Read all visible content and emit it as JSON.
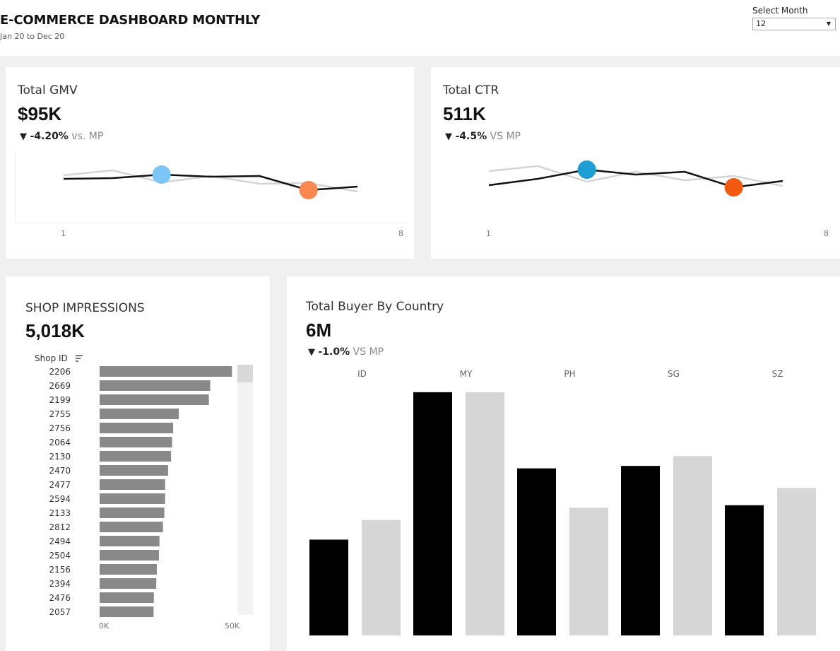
{
  "header": {
    "title": "E-COMMERCE DASHBOARD MONTHLY",
    "subtitle": "Jan 20 to Dec 20",
    "filter_label": "Select Month",
    "filter_value": "12"
  },
  "gmv": {
    "title": "Total GMV",
    "value": "$95K",
    "delta_arrow": "▼",
    "delta_pct": "-4.20%",
    "delta_suffix": "vs. MP",
    "x_start": "1",
    "x_end": "8",
    "highlight_high_color": "#7cc6f7",
    "highlight_low_color": "#f98850"
  },
  "ctr": {
    "title": "Total CTR",
    "value": "511K",
    "delta_arrow": "▼",
    "delta_pct": "-4.5%",
    "delta_suffix": "VS MP",
    "x_start": "1",
    "x_end": "8",
    "highlight_high_color": "#1f9ed6",
    "highlight_low_color": "#f25a0f"
  },
  "shops": {
    "title": "SHOP IMPRESSIONS",
    "value": "5,018K",
    "column_header": "Shop ID",
    "axis_start": "0K",
    "axis_end": "50K"
  },
  "buyers": {
    "title": "Total Buyer By Country",
    "value": "6M",
    "delta_arrow": "▼",
    "delta_pct": "-1.0%",
    "delta_suffix": "VS MP"
  },
  "chart_data": [
    {
      "type": "line",
      "x": [
        1,
        2,
        3,
        4,
        5,
        6,
        7,
        8
      ],
      "series": [
        {
          "values": [
            0.62,
            0.63,
            0.68,
            0.65,
            0.66,
            0.46,
            0.51
          ]
        },
        {
          "values": [
            0.67,
            0.74,
            0.57,
            0.66,
            0.55,
            0.56,
            0.44
          ]
        }
      ],
      "highlights": {
        "high_index": 2,
        "low_index": 5
      },
      "color_current": "#111111",
      "color_previous": "#d4d4d4"
    },
    {
      "type": "line",
      "x": [
        1,
        2,
        3,
        4,
        5,
        6,
        7,
        8
      ],
      "series": [
        {
          "values": [
            0.53,
            0.62,
            0.75,
            0.68,
            0.72,
            0.5,
            0.59
          ]
        },
        {
          "values": [
            0.73,
            0.8,
            0.58,
            0.72,
            0.6,
            0.66,
            0.52
          ]
        }
      ],
      "highlights": {
        "high_index": 2,
        "low_index": 5
      },
      "color_current": "#111111",
      "color_previous": "#d4d4d4"
    },
    {
      "type": "bar",
      "orientation": "horizontal",
      "categories": [
        "2206",
        "2669",
        "2199",
        "2755",
        "2756",
        "2064",
        "2130",
        "2470",
        "2477",
        "2594",
        "2133",
        "2812",
        "2494",
        "2504",
        "2156",
        "2394",
        "2476",
        "2057"
      ],
      "values": [
        49.3,
        41.2,
        40.7,
        29.5,
        27.4,
        27.0,
        26.6,
        25.5,
        24.4,
        24.4,
        24.1,
        23.6,
        22.3,
        22.1,
        21.3,
        21.1,
        20.2,
        20.1
      ],
      "xlim": [
        0,
        50
      ],
      "bar_color": "#898989"
    },
    {
      "type": "bar",
      "orientation": "vertical",
      "categories": [
        "ID",
        "MY",
        "PH",
        "SG",
        "SZ"
      ],
      "series": [
        {
          "values": [
            0.39,
            0.99,
            0.68,
            0.69,
            0.53
          ]
        },
        {
          "values": [
            0.47,
            0.99,
            0.52,
            0.73,
            0.6
          ]
        }
      ],
      "ylim": [
        0,
        1.05
      ],
      "colors": [
        "#000000",
        "#d6d6d6"
      ]
    }
  ]
}
